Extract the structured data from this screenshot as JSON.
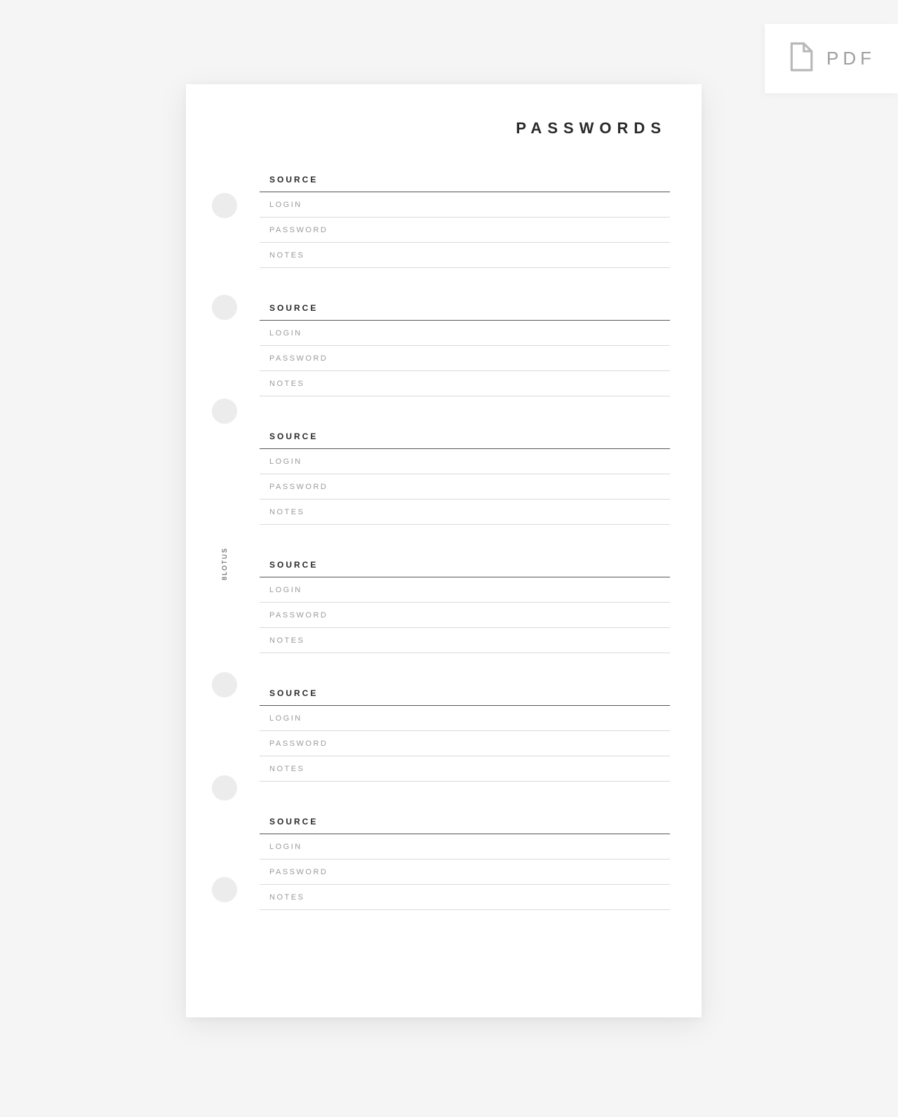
{
  "pdf_badge": {
    "label": "PDF"
  },
  "page": {
    "title": "PASSWORDS",
    "brand": "8LOTUS"
  },
  "labels": {
    "source": "SOURCE",
    "login": "LOGIN",
    "password": "PASSWORD",
    "notes": "NOTES"
  }
}
